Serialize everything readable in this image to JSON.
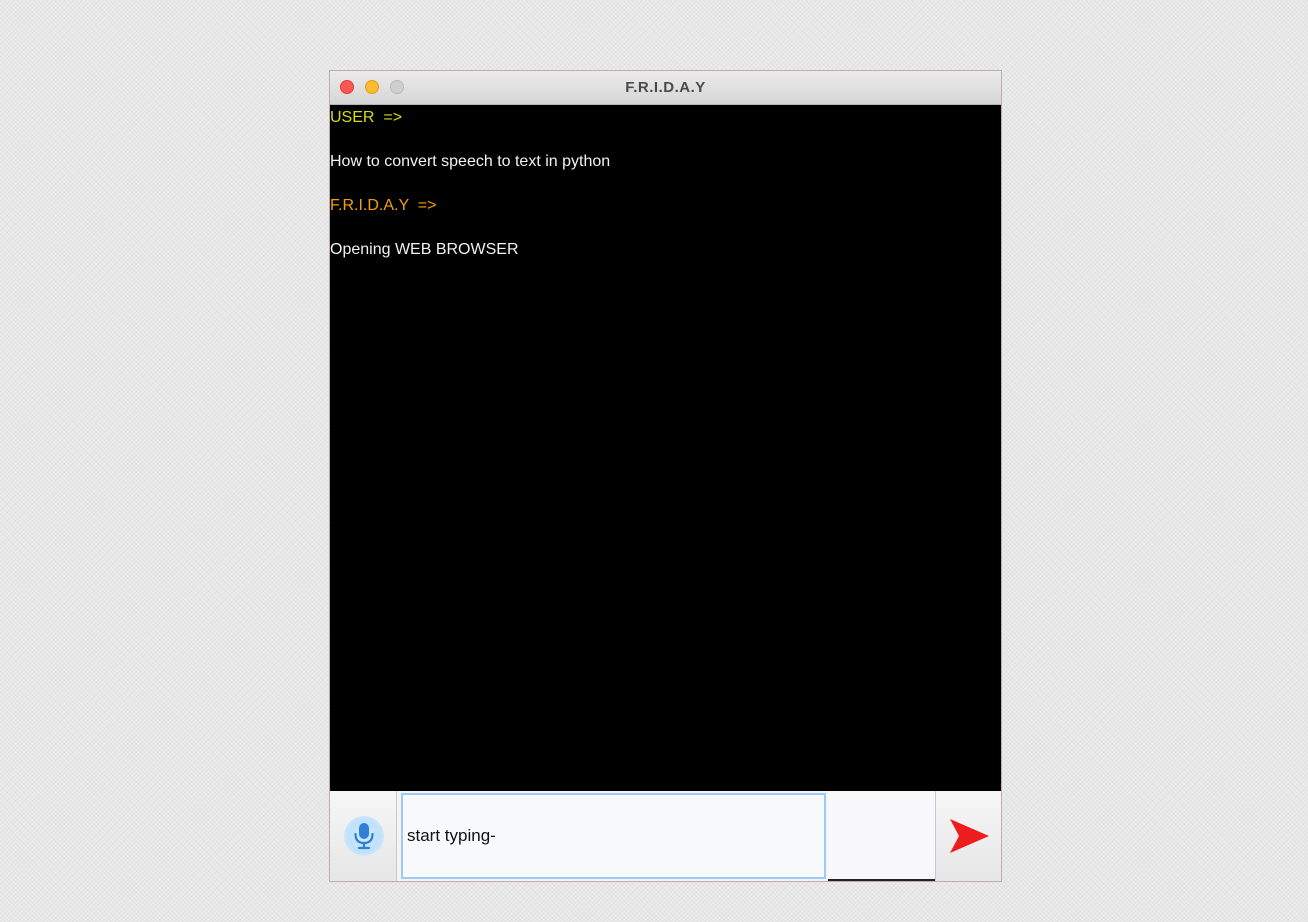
{
  "window": {
    "title": "F.R.I.D.A.Y"
  },
  "chat": {
    "messages": [
      {
        "role": "user",
        "label": "USER  =>",
        "text": "How to convert speech to text in python"
      },
      {
        "role": "assistant",
        "label": "F.R.I.D.A.Y  =>",
        "text": "Opening WEB BROWSER"
      }
    ]
  },
  "input": {
    "value": "start typing-"
  },
  "icons": {
    "mic": "microphone-icon",
    "send": "send-arrow-icon"
  },
  "colors": {
    "user_label": "#d8dd0e",
    "assistant_label": "#f49f0a",
    "chat_background": "#000000",
    "send_arrow": "#ee1c1c",
    "mic": "#2f7fd6"
  }
}
